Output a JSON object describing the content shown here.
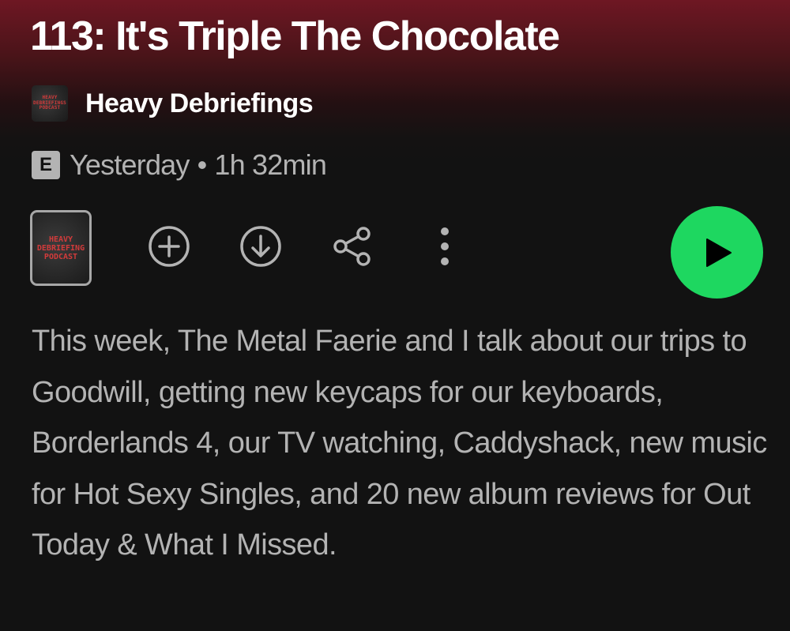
{
  "episode": {
    "title": "113: It's Triple The Chocolate"
  },
  "show": {
    "name": "Heavy Debriefings",
    "thumb_lines": [
      "HEAVY",
      "DEBRIEFINGS",
      "PODCAST"
    ],
    "cover_lines": [
      "HEAVY",
      "DEBRIEFING",
      "PODCAST"
    ]
  },
  "meta": {
    "explicit_badge": "E",
    "date": "Yesterday",
    "separator": "•",
    "duration": "1h 32min"
  },
  "actions": {
    "icons": [
      "add-icon",
      "download-icon",
      "share-icon",
      "more-options-icon",
      "play-icon"
    ]
  },
  "description": "This week, The Metal Faerie and I talk about our trips to Goodwill, getting new keycaps for our keyboards, Borderlands 4, our TV watching, Caddyshack, new music for Hot Sexy Singles, and 20 new album reviews for Out Today & What I Missed.",
  "colors": {
    "accent": "#1ed760",
    "header_gradient_top": "#6e1723",
    "background": "#121212",
    "secondary_text": "#b3b3b3",
    "artwork_text": "#d23b3b"
  }
}
